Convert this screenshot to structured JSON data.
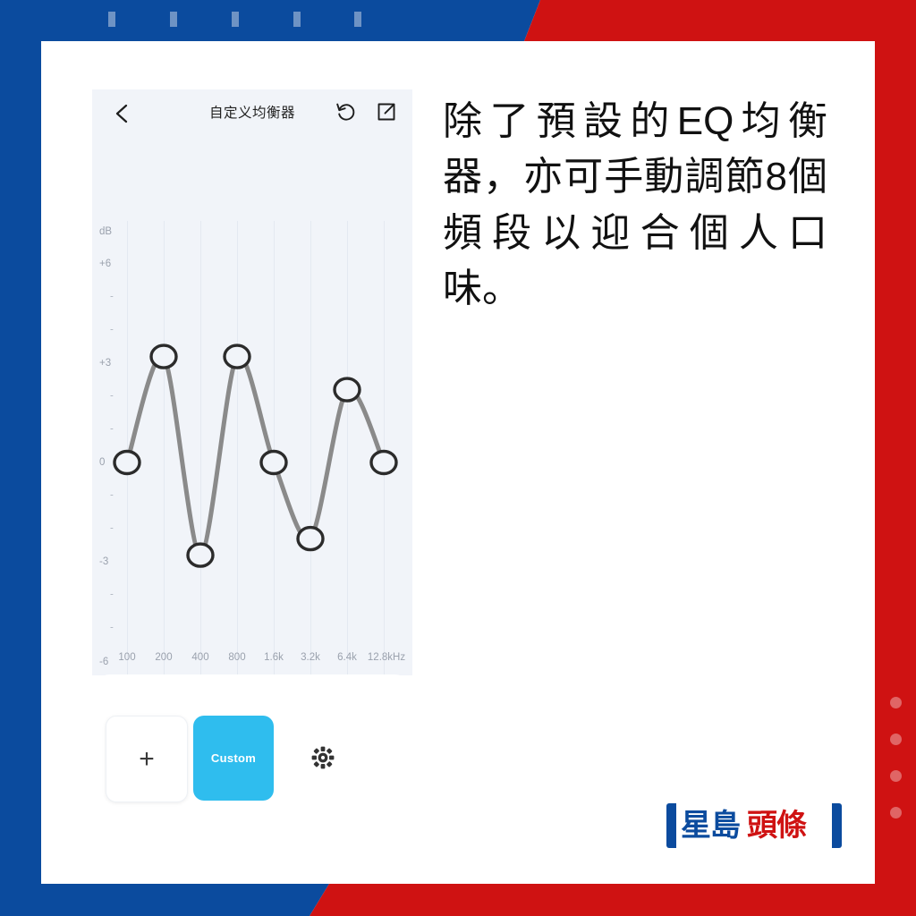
{
  "background": {
    "blue": "#0b4b9e",
    "red": "#cf1212",
    "dash_color": "#6e93c4",
    "dot_color": "#e06565"
  },
  "eq_app": {
    "title": "自定义均衡器",
    "back_icon": "chevron-left-icon",
    "reset_icon": "reset-circular-arrow-icon",
    "share_icon": "share-export-icon",
    "unit_label": "dB",
    "y_labels": [
      "+6",
      "+3",
      "0",
      "-3",
      "-6"
    ],
    "minor_tick": "-",
    "x_labels": [
      "100",
      "200",
      "400",
      "800",
      "1.6k",
      "3.2k",
      "6.4k",
      "12.8kHz"
    ],
    "curve_color": "#8a8a8a",
    "point_stroke": "#2b2b2b"
  },
  "presets": {
    "add_label": "+",
    "custom_label": "Custom",
    "custom_color": "#2fbdee",
    "gear_icon": "gear-icon"
  },
  "caption": {
    "text": "除了預設的EQ均衡器，亦可手動調節8個頻段以迎合個人口味。"
  },
  "logo": {
    "blue_text": "星島",
    "red_text": "頭條",
    "blue": "#0b4b9e",
    "red": "#cf1212"
  },
  "chart_data": {
    "type": "line",
    "title": "自定义均衡器",
    "xlabel": "",
    "ylabel": "dB",
    "categories": [
      "100",
      "200",
      "400",
      "800",
      "1.6k",
      "3.2k",
      "6.4k",
      "12.8kHz"
    ],
    "values": [
      0,
      3.2,
      -2.8,
      3.2,
      0,
      -2.3,
      2.2,
      0
    ],
    "ylim": [
      -6,
      6
    ],
    "yticks": [
      6,
      3,
      0,
      -3,
      -6
    ],
    "ytick_labels": [
      "+6",
      "+3",
      "0",
      "-3",
      "-6"
    ],
    "grid": "vertical",
    "legend": "none",
    "markers": "open-circle"
  }
}
